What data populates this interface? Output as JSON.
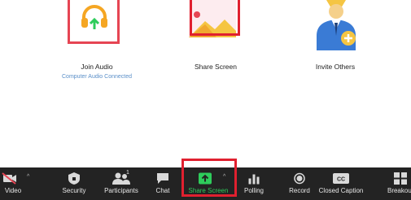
{
  "options": {
    "join_audio": {
      "label": "Join Audio",
      "sublabel": "Computer Audio Connected",
      "icon": "headphones-icon",
      "accent": "#f5a623"
    },
    "share_screen": {
      "label": "Share Screen",
      "icon": "share-screen-icon"
    },
    "invite_others": {
      "label": "Invite Others",
      "icon": "invite-others-icon"
    }
  },
  "toolbar": {
    "video_label": "Video",
    "security_label": "Security",
    "participants_label": "Participants",
    "participants_count": "1",
    "chat_label": "Chat",
    "share_screen_label": "Share Screen",
    "polling_label": "Polling",
    "record_label": "Record",
    "cc_label": "Closed Caption",
    "breakout_label": "Breakout",
    "accent_color": "#2ecc5b",
    "background_color": "#232323"
  },
  "highlight_color": "#e0202f"
}
